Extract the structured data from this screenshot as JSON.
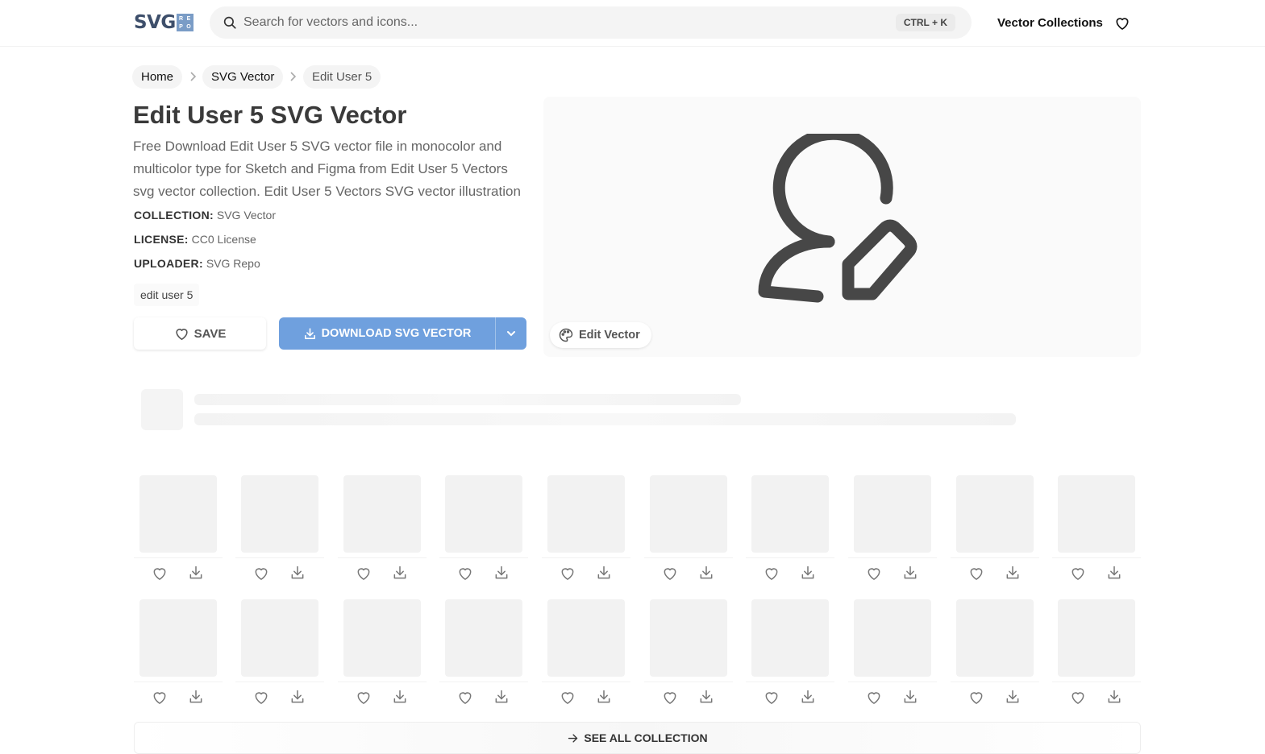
{
  "header": {
    "logo_text": "SVG",
    "logo_box": [
      "R",
      "E",
      "P",
      "O"
    ],
    "search_placeholder": "Search for vectors and icons...",
    "shortcut": "CTRL + K",
    "nav_collections": "Vector Collections",
    "icons": {
      "search": "search-icon",
      "favorites": "heart-icon"
    }
  },
  "breadcrumb": [
    "Home",
    "SVG Vector",
    "Edit User 5"
  ],
  "page": {
    "title": "Edit User 5 SVG Vector",
    "description": "Free Download Edit User 5 SVG vector file in monocolor and multicolor type for Sketch and Figma from Edit User 5 Vectors svg vector collection. Edit User 5 Vectors SVG vector illustration",
    "meta": [
      {
        "label": "COLLECTION:",
        "value": "SVG Vector"
      },
      {
        "label": "LICENSE:",
        "value": "CC0 License"
      },
      {
        "label": "UPLOADER:",
        "value": "SVG Repo"
      }
    ],
    "tag": "edit user 5",
    "save_label": "SAVE",
    "download_label": "DOWNLOAD SVG VECTOR",
    "edit_label": "Edit Vector",
    "see_all_label": "SEE ALL COLLECTION",
    "colors": {
      "download_button": "#6fa0de",
      "icon_stroke": "#474747",
      "logo": "#3e4f6b"
    }
  },
  "grid": {
    "rows": 2,
    "cols": 10
  }
}
